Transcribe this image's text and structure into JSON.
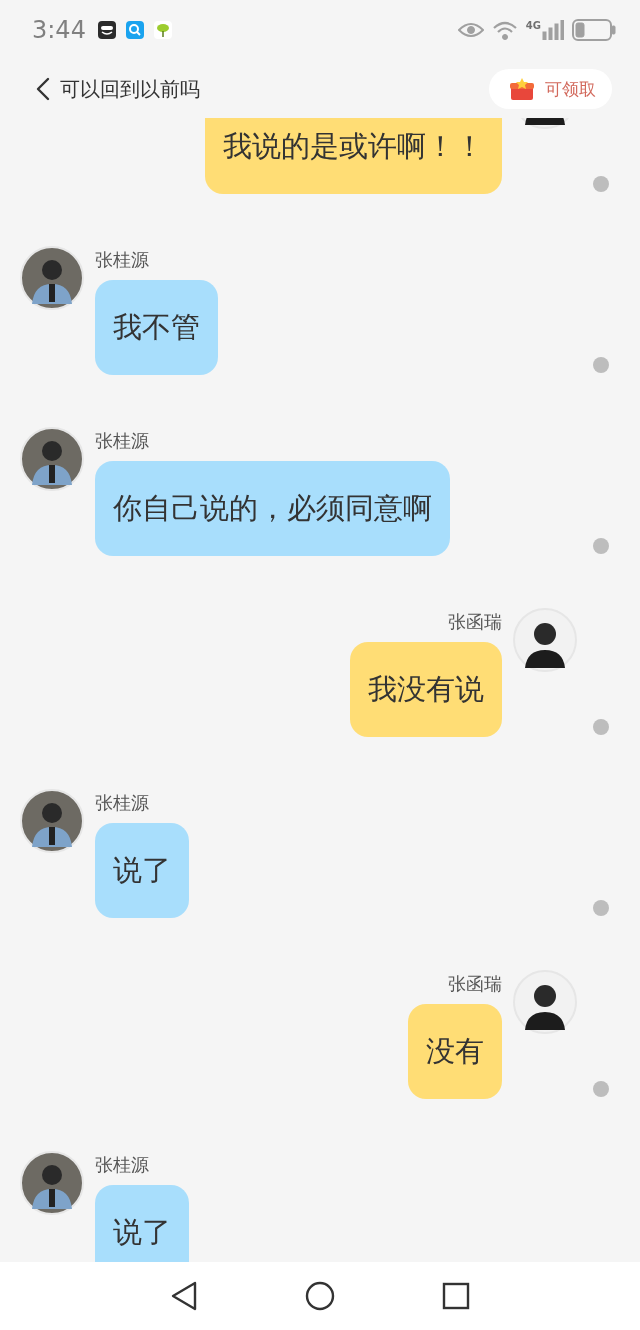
{
  "status_bar": {
    "time": "3:44",
    "network_type": "4G"
  },
  "header": {
    "title": "可以回到以前吗",
    "reward_button": "可领取"
  },
  "messages": [
    {
      "kind": "sent",
      "text": "我说的是或许啊！！"
    },
    {
      "kind": "received",
      "name": "张桂源",
      "text": "我不管"
    },
    {
      "kind": "received",
      "name": "张桂源",
      "text": "你自己说的，必须同意啊"
    },
    {
      "kind": "sent",
      "name": "张函瑞",
      "text": "我没有说"
    },
    {
      "kind": "received",
      "name": "张桂源",
      "text": "说了"
    },
    {
      "kind": "sent",
      "name": "张函瑞",
      "text": "没有"
    },
    {
      "kind": "received",
      "name": "张桂源",
      "text": "说了"
    }
  ]
}
